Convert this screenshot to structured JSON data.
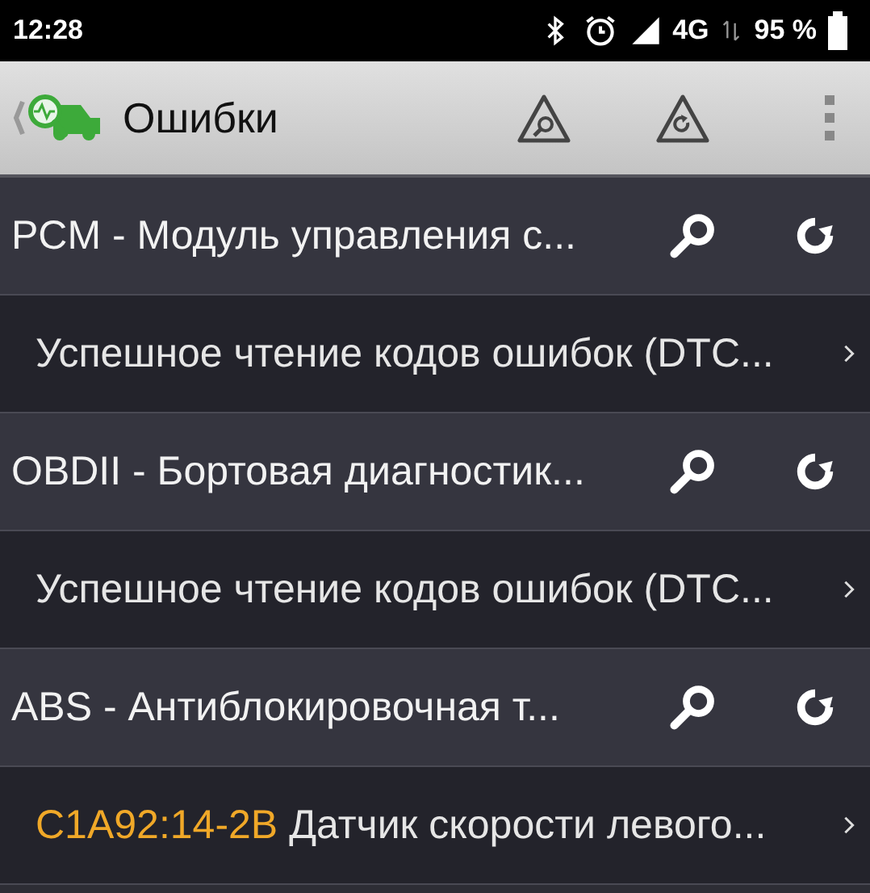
{
  "status_bar": {
    "time": "12:28",
    "network": "4G",
    "battery": "95 %"
  },
  "toolbar": {
    "title": "Ошибки"
  },
  "modules": [
    {
      "name": "PCM - Модуль управления с...",
      "results": [
        {
          "kind": "status",
          "text": "Успешное чтение кодов ошибок (DTC..."
        }
      ]
    },
    {
      "name": "OBDII - Бортовая диагностик...",
      "results": [
        {
          "kind": "status",
          "text": "Успешное чтение кодов ошибок (DTC..."
        }
      ]
    },
    {
      "name": "ABS - Антиблокировочная т...",
      "results": [
        {
          "kind": "dtc",
          "code": "C1A92:14-2B",
          "text": "Датчик скорости левого..."
        }
      ]
    }
  ]
}
